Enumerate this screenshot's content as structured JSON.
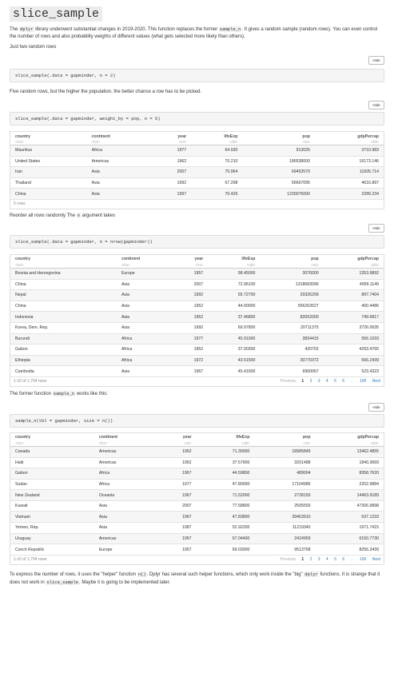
{
  "title": "slice_sample",
  "intro": {
    "p1": "The",
    "p1_code": "dplyr",
    "p1_rest": "library underwent substantial changes in 2019-2020. This function replaces the former",
    "p1_code2": "sample_n",
    "p1_rest2": ". It gives a random sample (random rows). You can even control the number of rows and also probability weights of different values (what gets selected more likely than others).",
    "p2": "Just two random rows"
  },
  "hide_label": "Hide",
  "code1": "slice_sample(.data = gapminder, n = 2)",
  "text2": "Five random rows, but the higher the population, the better chance a row has to be picked.",
  "code2": "slice_sample(.data = gapminder, weight_by = pop, n = 5)",
  "columns": [
    "country",
    "continent",
    "year",
    "lifeExp",
    "pop",
    "gdpPercap"
  ],
  "types": [
    "<fctr>",
    "<fctr>",
    "<int>",
    "<dbl>",
    "<int>",
    "<dbl>"
  ],
  "table1": {
    "rows": [
      [
        "Mauritius",
        "Africa",
        "1977",
        "64.930",
        "913025",
        "3710.983"
      ],
      [
        "United States",
        "Americas",
        "1962",
        "70.210",
        "186538000",
        "16173.146"
      ],
      [
        "Iran",
        "Asia",
        "2007",
        "70.964",
        "69453570",
        "11605.714"
      ],
      [
        "Thailand",
        "Asia",
        "1992",
        "67.298",
        "56667095",
        "4616.897"
      ],
      [
        "China",
        "Asia",
        "1997",
        "70.426",
        "1230075000",
        "2289.234"
      ]
    ],
    "footer": "5 rows"
  },
  "text3": {
    "a": "Reorder all rows randomly The",
    "code": "n",
    "b": "argument takes"
  },
  "code3": "slice_sample(.data = gapminder, n = nrow(gapminder))",
  "table2": {
    "rows": [
      [
        "Bosnia and Herzegovina",
        "Europe",
        "1957",
        "58.45000",
        "3076000",
        "1353.9892"
      ],
      [
        "China",
        "Asia",
        "2007",
        "72.96100",
        "1318683096",
        "4959.1149"
      ],
      [
        "Nepal",
        "Asia",
        "1992",
        "55.72700",
        "20326209",
        "897.7404"
      ],
      [
        "China",
        "Asia",
        "1952",
        "44.00000",
        "556263527",
        "400.4486"
      ],
      [
        "Indonesia",
        "Asia",
        "1952",
        "37.46800",
        "82052000",
        "749.6817"
      ],
      [
        "Korea, Dem. Rep.",
        "Asia",
        "1992",
        "69.97800",
        "20711375",
        "3726.0635"
      ],
      [
        "Burundi",
        "Africa",
        "1977",
        "45.91000",
        "3834415",
        "556.1033"
      ],
      [
        "Gabon",
        "Africa",
        "1952",
        "37.00300",
        "420702",
        "4293.4765"
      ],
      [
        "Ethiopia",
        "Africa",
        "1972",
        "43.51500",
        "30770372",
        "566.2439"
      ],
      [
        "Cambodia",
        "Asia",
        "1967",
        "45.41500",
        "6960067",
        "523.4323"
      ]
    ],
    "footer": "1-10 of 1,704 rows"
  },
  "pager": {
    "prev": "Previous",
    "pages": [
      "1",
      "2",
      "3",
      "4",
      "5",
      "6"
    ],
    "ellipsis": "...",
    "last": "100",
    "next": "Next"
  },
  "text4": {
    "a": "The former function",
    "code": "sample_n",
    "b": "works like this:"
  },
  "code4": "sample_n(tbl = gapminder, size = n())",
  "table3": {
    "rows": [
      [
        "Canada",
        "Americas",
        "1962",
        "71.30000",
        "18985849",
        "13462.4855"
      ],
      [
        "Haiti",
        "Americas",
        "1952",
        "37.57900",
        "3201488",
        "1840.3669"
      ],
      [
        "Gabon",
        "Africa",
        "1967",
        "44.59800",
        "489004",
        "8358.7620"
      ],
      [
        "Sudan",
        "Africa",
        "1977",
        "47.80000",
        "17104986",
        "2202.9884"
      ],
      [
        "New Zealand",
        "Oceania",
        "1967",
        "71.52000",
        "2728150",
        "14463.9189"
      ],
      [
        "Kuwait",
        "Asia",
        "2007",
        "77.58800",
        "2505559",
        "47306.9898"
      ],
      [
        "Vietnam",
        "Asia",
        "1967",
        "47.83800",
        "39463910",
        "637.1233"
      ],
      [
        "Yemen, Rep.",
        "Asia",
        "1987",
        "52.92200",
        "11219340",
        "1971.7415"
      ],
      [
        "Uruguay",
        "Americas",
        "1957",
        "67.04400",
        "2424959",
        "6150.7730"
      ],
      [
        "Czech Republic",
        "Europe",
        "1957",
        "69.03000",
        "9513758",
        "8256.3439"
      ]
    ],
    "footer": "1-10 of 1,704 rows"
  },
  "outro": {
    "a": "To express the number of rows, it uses the \"helper\" function",
    "code": "n()",
    "b": ". Dplyr has several such helper functions, which only work inside the \"big\"",
    "code2": "dplyr",
    "c": "functions. It is strange that it does not work in",
    "code3": "slice_sample",
    "d": ". Maybe it is going to be implemented later."
  }
}
